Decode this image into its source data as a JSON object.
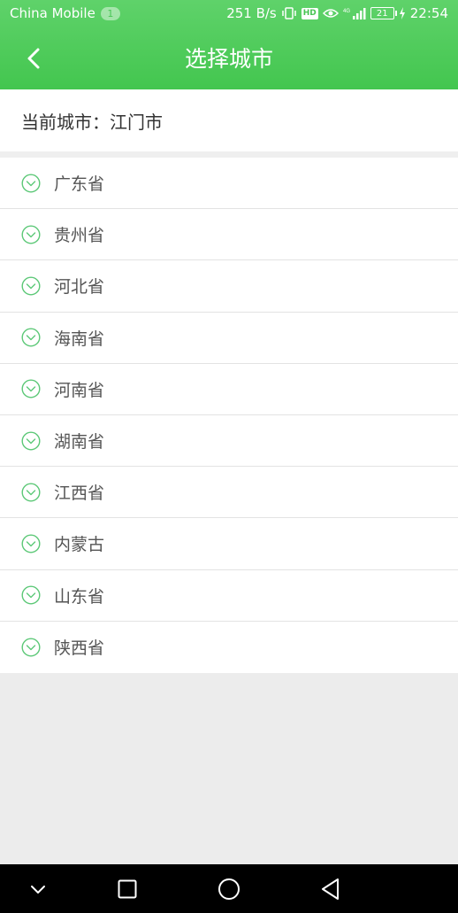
{
  "status_bar": {
    "carrier": "China Mobile",
    "notification_count": "1",
    "network_speed": "251 B/s",
    "hd_label": "HD",
    "battery": "21",
    "time": "22:54"
  },
  "header": {
    "title": "选择城市"
  },
  "current_city": {
    "text": "当前城市：江门市"
  },
  "provinces": [
    {
      "label": "广东省"
    },
    {
      "label": "贵州省"
    },
    {
      "label": "河北省"
    },
    {
      "label": "海南省"
    },
    {
      "label": "河南省"
    },
    {
      "label": "湖南省"
    },
    {
      "label": "江西省"
    },
    {
      "label": "内蒙古"
    },
    {
      "label": "山东省"
    },
    {
      "label": "陕西省"
    }
  ],
  "colors": {
    "accent_green": "#4ac656",
    "icon_green": "#5cc877"
  },
  "icons": {
    "back": "chevron-left-icon",
    "expand": "chevron-down-circle-icon",
    "nav_down": "chevron-down-icon",
    "nav_recents": "square-icon",
    "nav_home": "circle-icon",
    "nav_back": "triangle-left-icon"
  }
}
